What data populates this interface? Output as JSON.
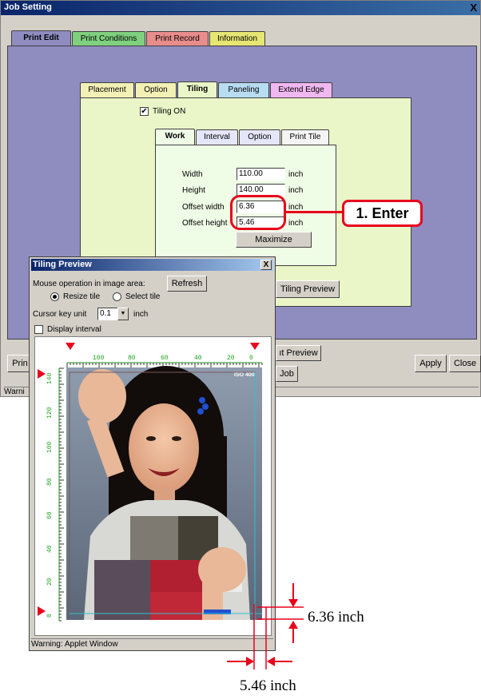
{
  "job_window": {
    "title": "Job Setting",
    "close_glyph": "X",
    "tabs": [
      "Print Edit",
      "Print Conditions",
      "Print Record",
      "Information"
    ],
    "sub_tabs": [
      "Placement",
      "Option",
      "Tiling",
      "Paneling",
      "Extend Edge"
    ],
    "tiling_on_label": "Tiling ON",
    "tiling_on_checked": true,
    "inner_tabs": [
      "Work",
      "Interval",
      "Option",
      "Print Tile"
    ],
    "fields": [
      {
        "label": "Width",
        "value": "110.00",
        "unit": "inch"
      },
      {
        "label": "Height",
        "value": "140.00",
        "unit": "inch"
      },
      {
        "label": "Offset width",
        "value": "6.36",
        "unit": "inch"
      },
      {
        "label": "Offset height",
        "value": "5.46",
        "unit": "inch"
      }
    ],
    "maximize_label": "Maximize",
    "tiling_preview_label": "Tiling Preview",
    "layout_preview_label": "ıt Preview",
    "job_label": "Job",
    "print_label": "Prin",
    "apply_label": "Apply",
    "close_label": "Close",
    "status_warning": "Warni"
  },
  "callout": {
    "label": "1. Enter",
    "color": "#e8001c"
  },
  "preview_window": {
    "title": "Tiling Preview",
    "close_glyph": "X",
    "mouse_label": "Mouse operation in image area:",
    "refresh_label": "Refresh",
    "radio_options": [
      "Resize tile",
      "Select tile"
    ],
    "radio_selected": 0,
    "cursor_unit_label": "Cursor key unit",
    "cursor_unit_value": "0.1",
    "cursor_unit_suffix": "inch",
    "display_interval_label": "Display interval",
    "display_interval_checked": false,
    "top_ruler_labels": [
      "100",
      "80",
      "60",
      "40",
      "20",
      "0"
    ],
    "left_ruler_labels": [
      "140",
      "120",
      "100",
      "80",
      "60",
      "40",
      "20",
      "0"
    ],
    "iso_label": "ISO 400",
    "status_warning": "Warning: Applet Window"
  },
  "dimensions": {
    "offset_width_label": "6.36 inch",
    "offset_height_label": "5.46 inch"
  },
  "colors": {
    "purple_panel": "#8f8cc0",
    "green_panel": "#eaf6c8",
    "light_green_panel": "#effce6",
    "ruler_green": "#1ea01e",
    "marker_red": "#e8001c"
  }
}
